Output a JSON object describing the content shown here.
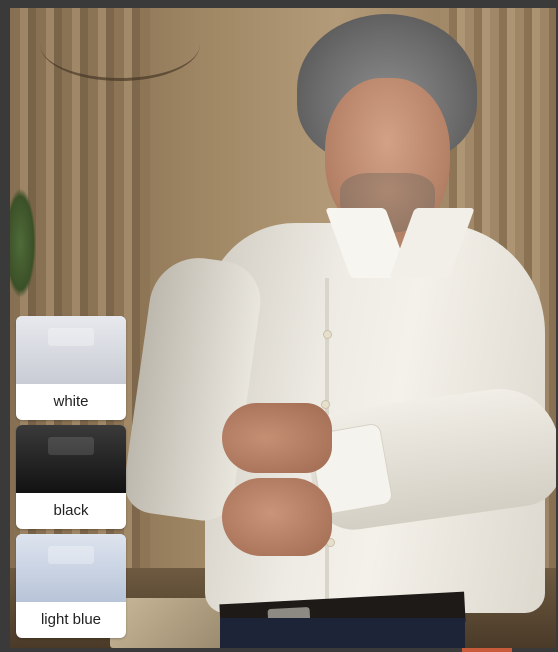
{
  "product": {
    "colour_options": [
      {
        "label": "white",
        "swatch_color": "#e7e9ee"
      },
      {
        "label": "black",
        "swatch_color": "#1f1f1f"
      },
      {
        "label": "light blue",
        "swatch_color": "#cdd6e5"
      }
    ]
  },
  "colors": {
    "accent": "#c75b3a",
    "frame": "#3a3a3a"
  }
}
